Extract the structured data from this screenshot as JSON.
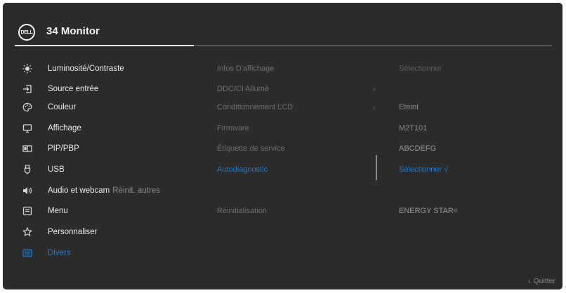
{
  "header": {
    "title": "34 Monitor",
    "logo_text": "DELL"
  },
  "menu": {
    "items": [
      {
        "label": "Luminosité/Contraste",
        "icon": "brightness-icon"
      },
      {
        "label": "Source entrée",
        "icon": "input-source-icon"
      },
      {
        "label": "Couleur",
        "icon": "color-icon"
      },
      {
        "label": "Affichage",
        "icon": "display-icon"
      },
      {
        "label": "PIP/PBP",
        "icon": "pip-pbp-icon"
      },
      {
        "label": "USB",
        "icon": "usb-icon"
      },
      {
        "label": "Audio et webcam",
        "sub": "Réinit. autres",
        "icon": "audio-webcam-icon"
      },
      {
        "label": "Menu",
        "icon": "menu-icon"
      },
      {
        "label": "Personnaliser",
        "icon": "star-icon"
      },
      {
        "label": "Divers",
        "icon": "others-icon",
        "active": true
      }
    ]
  },
  "submenu": {
    "items": [
      "Infos D'affichage",
      "DDC/CI Allumé",
      "Conditionnement LCD",
      "Firmware",
      "Étiquette de service",
      "Autodiagnostic",
      "Réinitialisation"
    ]
  },
  "values": {
    "infos": "Sélectionner",
    "lcd": "Eteint",
    "firmware": "M2T101",
    "service_tag": "ABCDEFG",
    "autodiag": "Sélectionner √",
    "energy": "ENERGY STAR",
    "energy_mark": "®"
  },
  "footer": {
    "quit_label": "Quitter",
    "quit_arrow": "‹"
  }
}
